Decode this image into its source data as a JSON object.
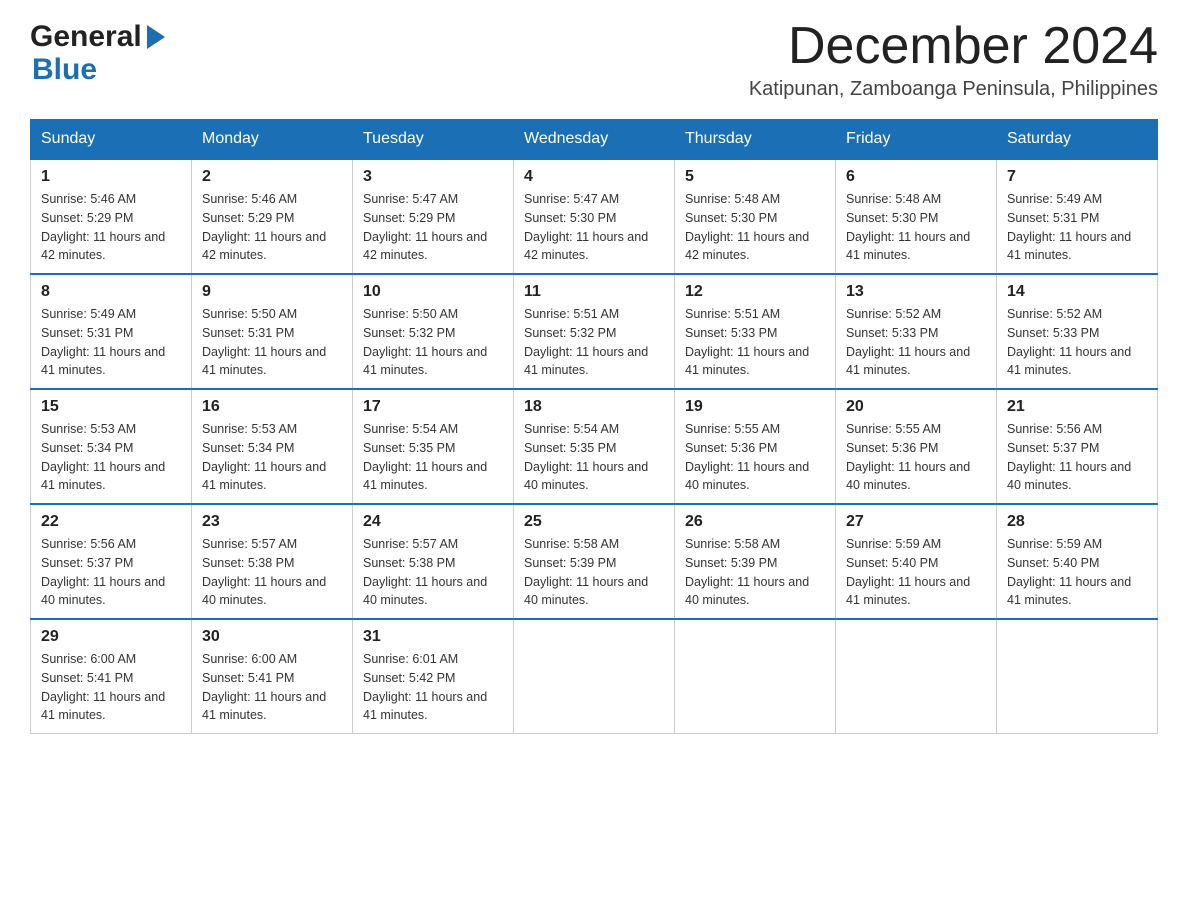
{
  "header": {
    "logo_general": "General",
    "logo_blue": "Blue",
    "month_title": "December 2024",
    "location": "Katipunan, Zamboanga Peninsula, Philippines"
  },
  "days_of_week": [
    "Sunday",
    "Monday",
    "Tuesday",
    "Wednesday",
    "Thursday",
    "Friday",
    "Saturday"
  ],
  "weeks": [
    [
      {
        "day": "1",
        "sunrise": "5:46 AM",
        "sunset": "5:29 PM",
        "daylight": "11 hours and 42 minutes."
      },
      {
        "day": "2",
        "sunrise": "5:46 AM",
        "sunset": "5:29 PM",
        "daylight": "11 hours and 42 minutes."
      },
      {
        "day": "3",
        "sunrise": "5:47 AM",
        "sunset": "5:29 PM",
        "daylight": "11 hours and 42 minutes."
      },
      {
        "day": "4",
        "sunrise": "5:47 AM",
        "sunset": "5:30 PM",
        "daylight": "11 hours and 42 minutes."
      },
      {
        "day": "5",
        "sunrise": "5:48 AM",
        "sunset": "5:30 PM",
        "daylight": "11 hours and 42 minutes."
      },
      {
        "day": "6",
        "sunrise": "5:48 AM",
        "sunset": "5:30 PM",
        "daylight": "11 hours and 41 minutes."
      },
      {
        "day": "7",
        "sunrise": "5:49 AM",
        "sunset": "5:31 PM",
        "daylight": "11 hours and 41 minutes."
      }
    ],
    [
      {
        "day": "8",
        "sunrise": "5:49 AM",
        "sunset": "5:31 PM",
        "daylight": "11 hours and 41 minutes."
      },
      {
        "day": "9",
        "sunrise": "5:50 AM",
        "sunset": "5:31 PM",
        "daylight": "11 hours and 41 minutes."
      },
      {
        "day": "10",
        "sunrise": "5:50 AM",
        "sunset": "5:32 PM",
        "daylight": "11 hours and 41 minutes."
      },
      {
        "day": "11",
        "sunrise": "5:51 AM",
        "sunset": "5:32 PM",
        "daylight": "11 hours and 41 minutes."
      },
      {
        "day": "12",
        "sunrise": "5:51 AM",
        "sunset": "5:33 PM",
        "daylight": "11 hours and 41 minutes."
      },
      {
        "day": "13",
        "sunrise": "5:52 AM",
        "sunset": "5:33 PM",
        "daylight": "11 hours and 41 minutes."
      },
      {
        "day": "14",
        "sunrise": "5:52 AM",
        "sunset": "5:33 PM",
        "daylight": "11 hours and 41 minutes."
      }
    ],
    [
      {
        "day": "15",
        "sunrise": "5:53 AM",
        "sunset": "5:34 PM",
        "daylight": "11 hours and 41 minutes."
      },
      {
        "day": "16",
        "sunrise": "5:53 AM",
        "sunset": "5:34 PM",
        "daylight": "11 hours and 41 minutes."
      },
      {
        "day": "17",
        "sunrise": "5:54 AM",
        "sunset": "5:35 PM",
        "daylight": "11 hours and 41 minutes."
      },
      {
        "day": "18",
        "sunrise": "5:54 AM",
        "sunset": "5:35 PM",
        "daylight": "11 hours and 40 minutes."
      },
      {
        "day": "19",
        "sunrise": "5:55 AM",
        "sunset": "5:36 PM",
        "daylight": "11 hours and 40 minutes."
      },
      {
        "day": "20",
        "sunrise": "5:55 AM",
        "sunset": "5:36 PM",
        "daylight": "11 hours and 40 minutes."
      },
      {
        "day": "21",
        "sunrise": "5:56 AM",
        "sunset": "5:37 PM",
        "daylight": "11 hours and 40 minutes."
      }
    ],
    [
      {
        "day": "22",
        "sunrise": "5:56 AM",
        "sunset": "5:37 PM",
        "daylight": "11 hours and 40 minutes."
      },
      {
        "day": "23",
        "sunrise": "5:57 AM",
        "sunset": "5:38 PM",
        "daylight": "11 hours and 40 minutes."
      },
      {
        "day": "24",
        "sunrise": "5:57 AM",
        "sunset": "5:38 PM",
        "daylight": "11 hours and 40 minutes."
      },
      {
        "day": "25",
        "sunrise": "5:58 AM",
        "sunset": "5:39 PM",
        "daylight": "11 hours and 40 minutes."
      },
      {
        "day": "26",
        "sunrise": "5:58 AM",
        "sunset": "5:39 PM",
        "daylight": "11 hours and 40 minutes."
      },
      {
        "day": "27",
        "sunrise": "5:59 AM",
        "sunset": "5:40 PM",
        "daylight": "11 hours and 41 minutes."
      },
      {
        "day": "28",
        "sunrise": "5:59 AM",
        "sunset": "5:40 PM",
        "daylight": "11 hours and 41 minutes."
      }
    ],
    [
      {
        "day": "29",
        "sunrise": "6:00 AM",
        "sunset": "5:41 PM",
        "daylight": "11 hours and 41 minutes."
      },
      {
        "day": "30",
        "sunrise": "6:00 AM",
        "sunset": "5:41 PM",
        "daylight": "11 hours and 41 minutes."
      },
      {
        "day": "31",
        "sunrise": "6:01 AM",
        "sunset": "5:42 PM",
        "daylight": "11 hours and 41 minutes."
      },
      null,
      null,
      null,
      null
    ]
  ],
  "labels": {
    "sunrise": "Sunrise:",
    "sunset": "Sunset:",
    "daylight": "Daylight:"
  }
}
